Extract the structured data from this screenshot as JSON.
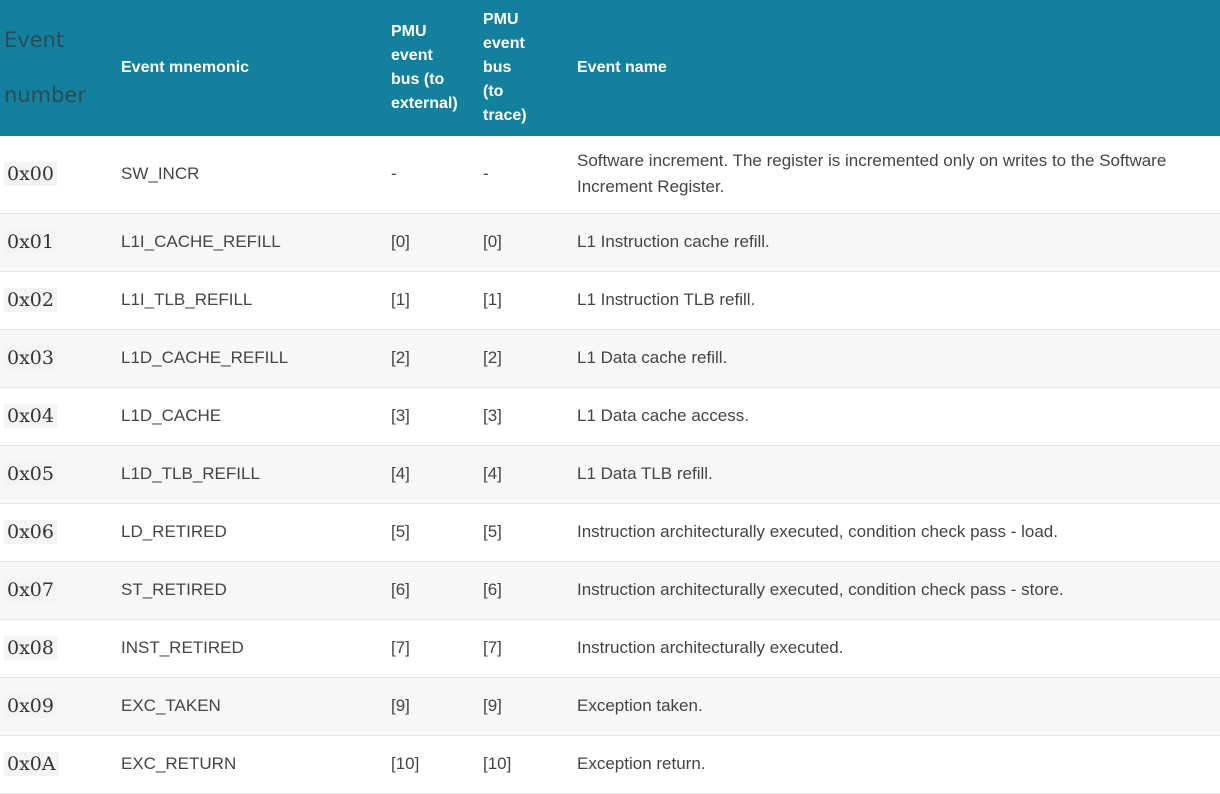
{
  "table": {
    "headers": {
      "event_number": [
        "Event",
        "number"
      ],
      "event_mnemonic": "Event mnemonic",
      "pmu_external": [
        "PMU",
        "event",
        "bus (to",
        "external)"
      ],
      "pmu_trace": [
        "PMU",
        "event",
        "bus",
        "(to",
        "trace)"
      ],
      "event_name": "Event name"
    },
    "rows": [
      {
        "number": "0x00",
        "mnemonic": "SW_INCR",
        "external": "-",
        "trace": "-",
        "name": "Software increment. The register is incremented only on writes to the Software Increment Register."
      },
      {
        "number": "0x01",
        "mnemonic": "L1I_CACHE_REFILL",
        "external": "[0]",
        "trace": "[0]",
        "name": "L1 Instruction cache refill."
      },
      {
        "number": "0x02",
        "mnemonic": "L1I_TLB_REFILL",
        "external": "[1]",
        "trace": "[1]",
        "name": "L1 Instruction TLB refill."
      },
      {
        "number": "0x03",
        "mnemonic": "L1D_CACHE_REFILL",
        "external": "[2]",
        "trace": "[2]",
        "name": "L1 Data cache refill."
      },
      {
        "number": "0x04",
        "mnemonic": "L1D_CACHE",
        "external": "[3]",
        "trace": "[3]",
        "name": "L1 Data cache access."
      },
      {
        "number": "0x05",
        "mnemonic": "L1D_TLB_REFILL",
        "external": "[4]",
        "trace": "[4]",
        "name": "L1 Data TLB refill."
      },
      {
        "number": "0x06",
        "mnemonic": "LD_RETIRED",
        "external": "[5]",
        "trace": "[5]",
        "name": "Instruction architecturally executed, condition check pass - load."
      },
      {
        "number": "0x07",
        "mnemonic": "ST_RETIRED",
        "external": "[6]",
        "trace": "[6]",
        "name": "Instruction architecturally executed, condition check pass - store."
      },
      {
        "number": "0x08",
        "mnemonic": "INST_RETIRED",
        "external": "[7]",
        "trace": "[7]",
        "name": "Instruction architecturally executed."
      },
      {
        "number": "0x09",
        "mnemonic": "EXC_TAKEN",
        "external": "[9]",
        "trace": "[9]",
        "name": "Exception taken."
      },
      {
        "number": "0x0A",
        "mnemonic": "EXC_RETURN",
        "external": "[10]",
        "trace": "[10]",
        "name": "Exception return."
      }
    ]
  },
  "colors": {
    "header_bg": "#13809e",
    "header_text": "#ffffff",
    "zebra_row": "#f7f7f7"
  }
}
